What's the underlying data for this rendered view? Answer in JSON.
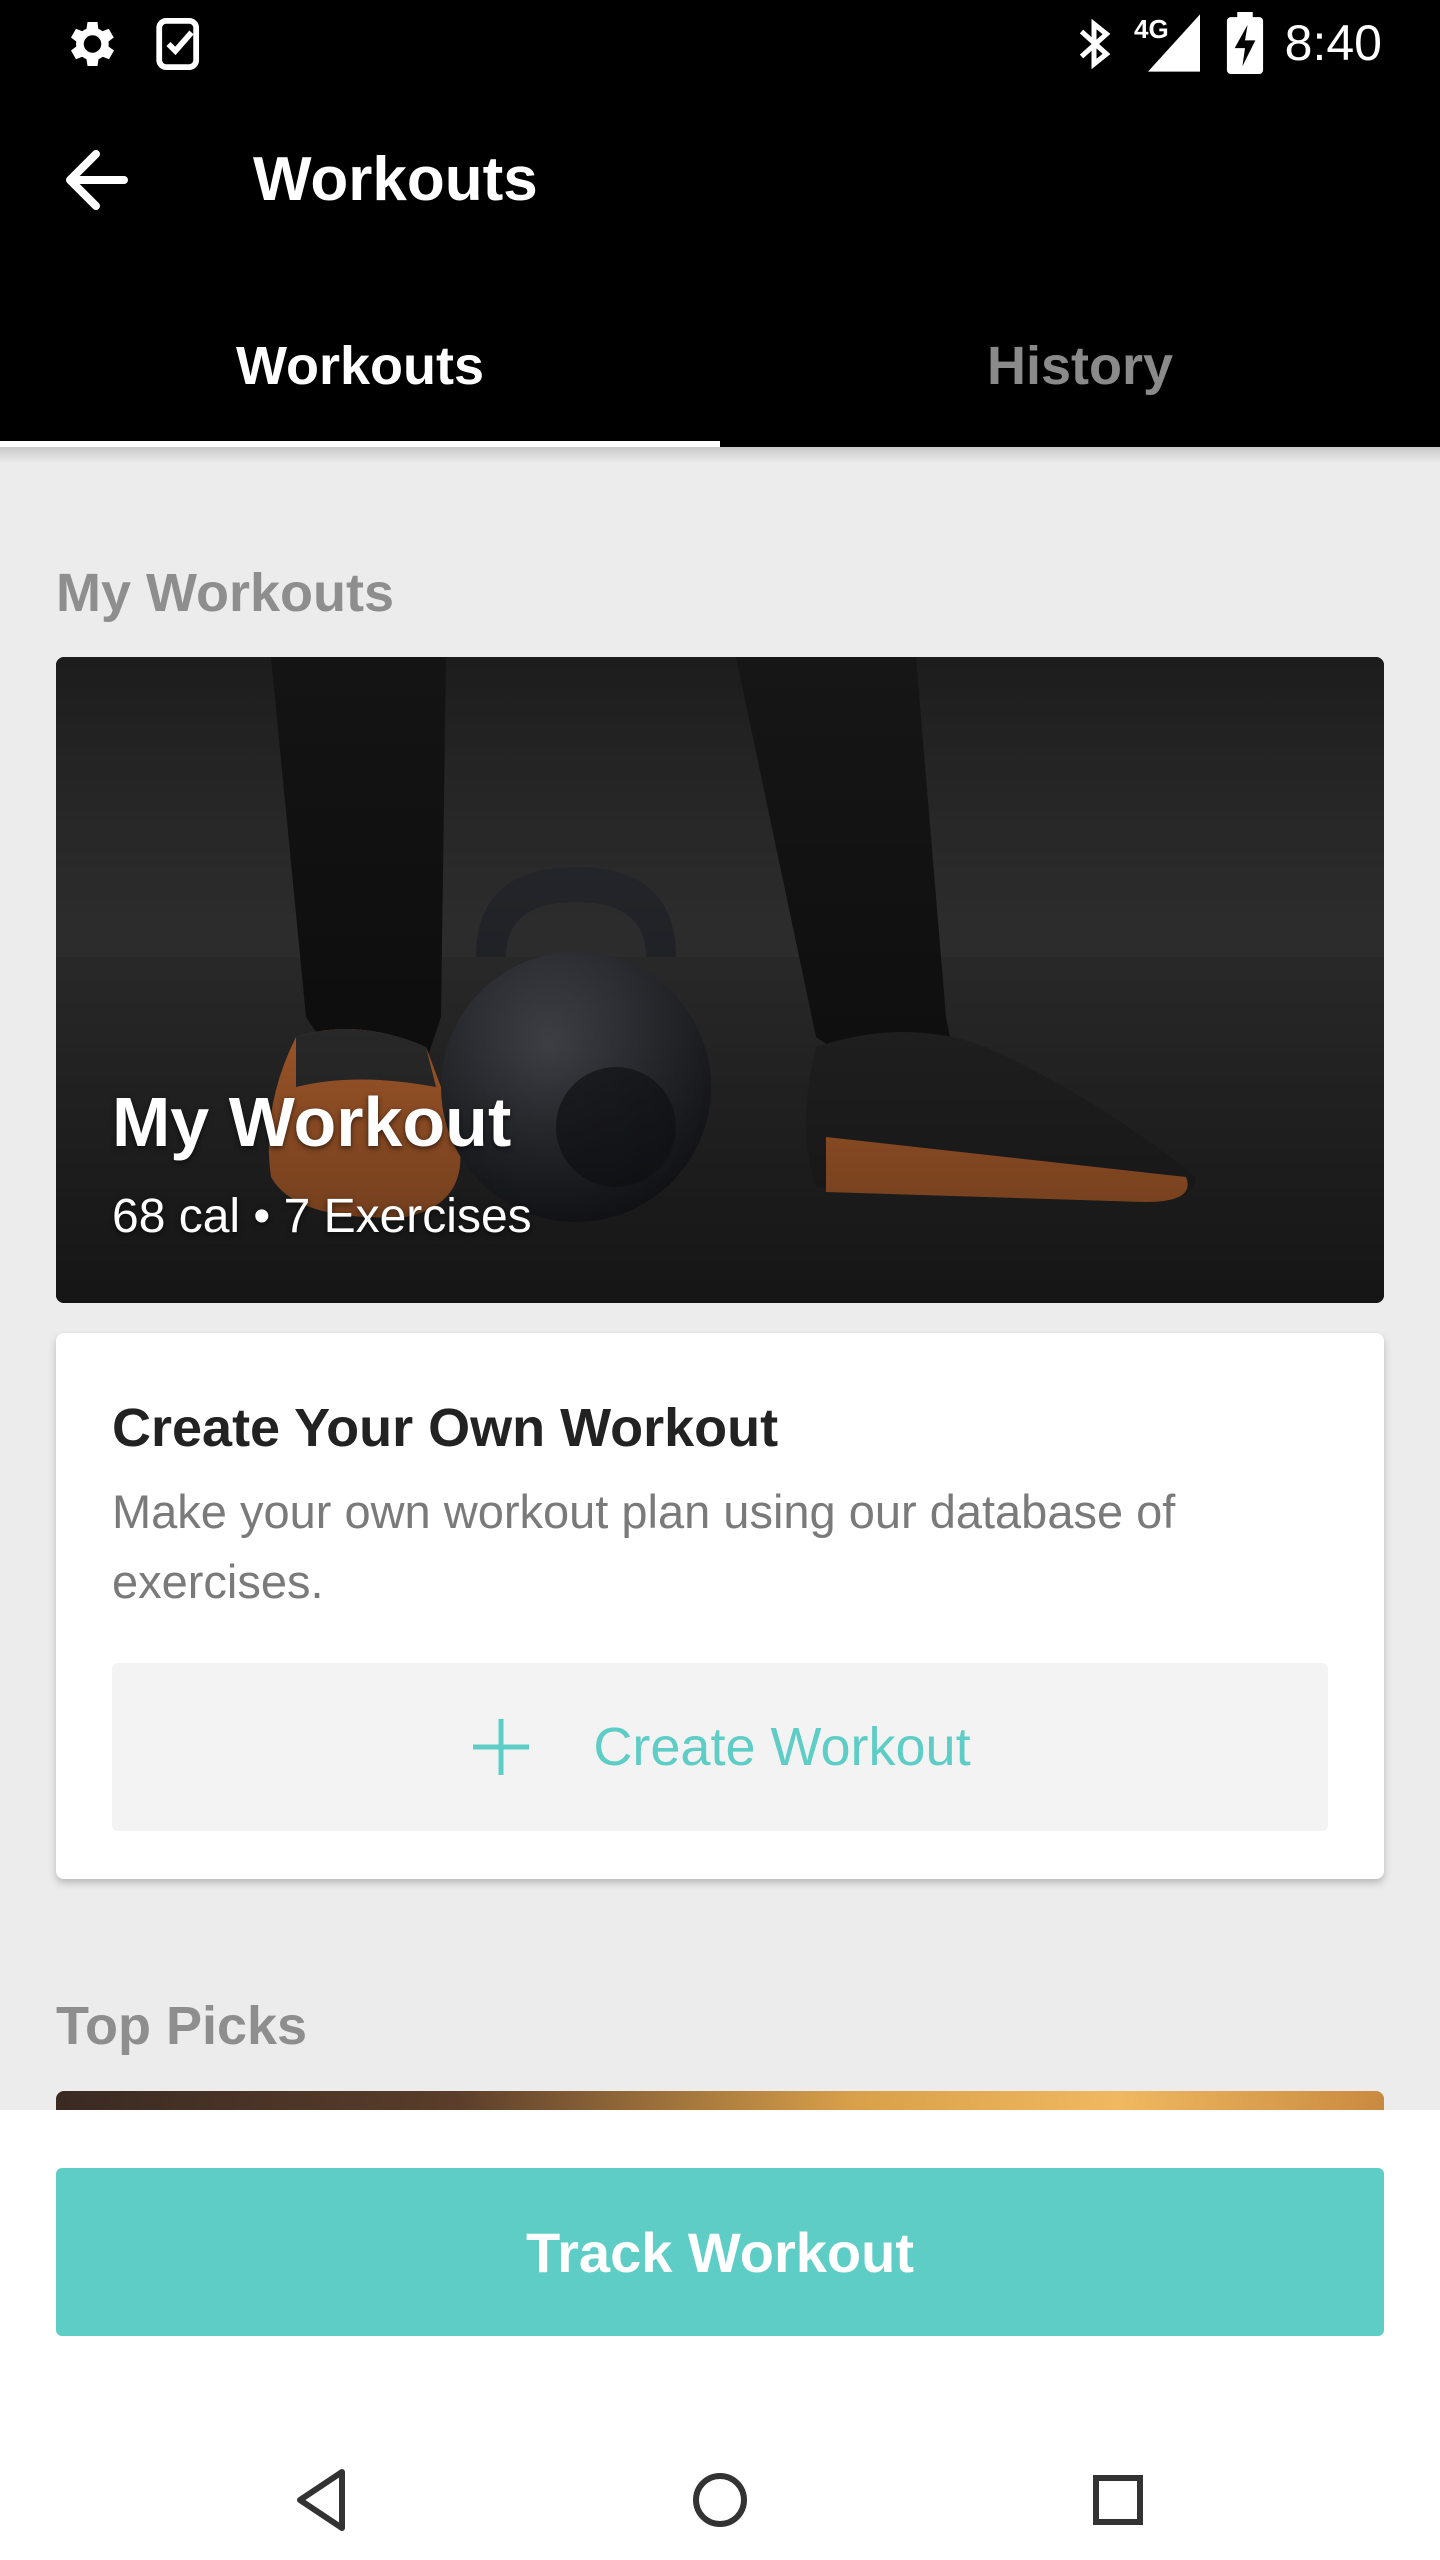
{
  "status_bar": {
    "time": "8:40",
    "network": "4G",
    "icons": [
      "gear-icon",
      "task-check-icon",
      "bluetooth-icon",
      "signal-icon",
      "battery-charging-icon"
    ]
  },
  "app_bar": {
    "title": "Workouts",
    "back_icon": "arrow-back-icon"
  },
  "tabs": [
    {
      "label": "Workouts",
      "active": true
    },
    {
      "label": "History",
      "active": false
    }
  ],
  "my_workouts": {
    "section_title": "My Workouts",
    "card": {
      "title": "My Workout",
      "subtitle": "68 cal • 7 Exercises"
    }
  },
  "create_card": {
    "title": "Create Your Own Workout",
    "description": "Make your own workout plan using our database of exercises.",
    "button_label": "Create Workout",
    "button_icon": "plus-icon"
  },
  "top_picks": {
    "section_title": "Top Picks"
  },
  "track_button": {
    "label": "Track Workout"
  },
  "nav_bar": {
    "icons": [
      "back-triangle-icon",
      "home-circle-icon",
      "recents-square-icon"
    ]
  },
  "colors": {
    "accent": "#5ecdc5",
    "background": "#ececec",
    "app_bar": "#000000"
  }
}
